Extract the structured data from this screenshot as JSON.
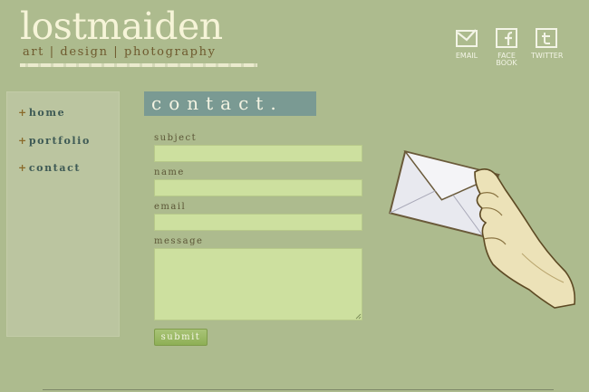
{
  "header": {
    "title": "lostmaiden",
    "tagline": "art | design | photography"
  },
  "social": [
    {
      "label": "EMAIL",
      "icon": "email-icon"
    },
    {
      "label": "FACE BOOK",
      "icon": "facebook-icon"
    },
    {
      "label": "TWITTER",
      "icon": "twitter-icon"
    }
  ],
  "nav": [
    {
      "label": "home"
    },
    {
      "label": "portfolio"
    },
    {
      "label": "contact"
    }
  ],
  "page": {
    "heading": "contact."
  },
  "form": {
    "subject_label": "subject",
    "subject_value": "",
    "name_label": "name",
    "name_value": "",
    "email_label": "email",
    "email_value": "",
    "message_label": "message",
    "message_value": "",
    "submit_label": "submit"
  },
  "colors": {
    "background": "#adbb8e",
    "sidebar": "#bbc5a0",
    "heading_bg": "#7a9a93",
    "field": "#cde09f",
    "button": "#9bb863"
  }
}
